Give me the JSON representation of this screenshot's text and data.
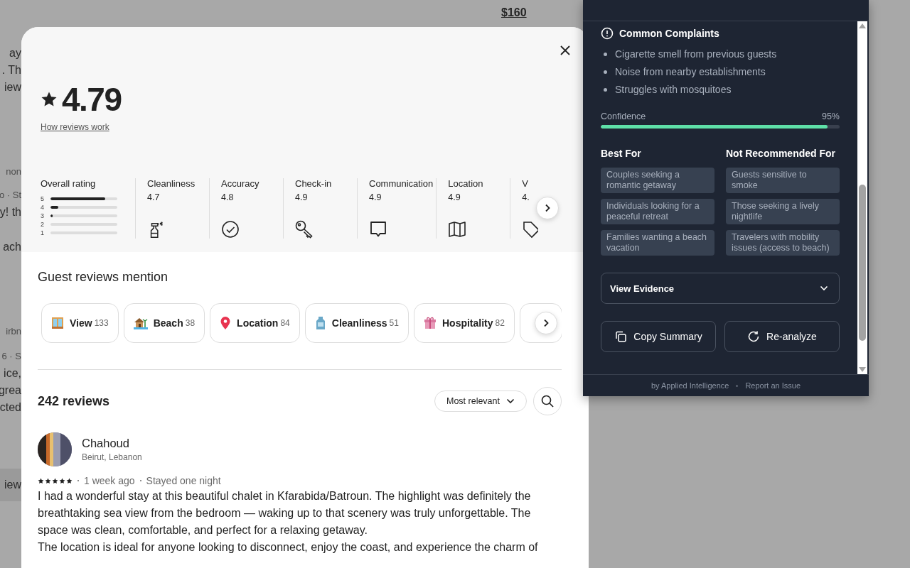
{
  "background_page": {
    "price": "$160",
    "fragments": [
      [
        {
          "text": "ay",
          "muted": false
        },
        {
          "text": ". Th",
          "muted": false
        },
        {
          "text": "iew",
          "muted": false
        }
      ],
      [
        {
          "text": "non",
          "muted": true
        }
      ],
      [
        {
          "text": "o · St",
          "muted": true
        },
        {
          "text": "y! th",
          "muted": false
        }
      ],
      [
        {
          "text": "ach",
          "muted": false
        }
      ],
      [
        {
          "text": "irbn",
          "muted": true
        }
      ],
      [
        {
          "text": "6 · S",
          "muted": true
        },
        {
          "text": "ice,",
          "muted": false
        },
        {
          "text": "grea",
          "muted": false
        },
        {
          "text": "cted",
          "muted": false
        }
      ],
      [
        {
          "text": "iew",
          "muted": false
        }
      ]
    ]
  },
  "reviews_modal": {
    "rating": "4.79",
    "how_link": "How reviews work",
    "overall": {
      "label": "Overall rating",
      "bars": [
        {
          "star": "5",
          "level": 0.82
        },
        {
          "star": "4",
          "level": 0.12
        },
        {
          "star": "3",
          "level": 0.03
        },
        {
          "star": "2",
          "level": 0
        },
        {
          "star": "1",
          "level": 0
        }
      ]
    },
    "categories": [
      {
        "kind": "spray",
        "name": "Cleanliness",
        "score": "4.7"
      },
      {
        "kind": "check",
        "name": "Accuracy",
        "score": "4.8"
      },
      {
        "kind": "key",
        "name": "Check-in",
        "score": "4.9"
      },
      {
        "kind": "message",
        "name": "Communication",
        "score": "4.9"
      },
      {
        "kind": "map",
        "name": "Location",
        "score": "4.9"
      },
      {
        "kind": "tag",
        "name": "V",
        "score": "4."
      }
    ],
    "mentions": {
      "title": "Guest reviews mention",
      "chips": [
        {
          "kind": "window",
          "label": "View",
          "count": "133"
        },
        {
          "kind": "hut",
          "label": "Beach",
          "count": "38"
        },
        {
          "kind": "pin",
          "label": "Location",
          "count": "84"
        },
        {
          "kind": "bottle",
          "label": "Cleanliness",
          "count": "51"
        },
        {
          "kind": "gift",
          "label": "Hospitality",
          "count": "82"
        }
      ]
    },
    "reviews": {
      "count": "242 reviews",
      "sort": "Most relevant",
      "items": [
        {
          "name": "Chahoud",
          "location": "Beirut, Lebanon",
          "stars": 5,
          "date": "1 week ago",
          "stay": "Stayed one night",
          "paragraphs": [
            "I had a wonderful stay at this beautiful chalet in Kfarabida/Batroun. The highlight was definitely the breathtaking sea view from the bedroom — waking up to that scenery was truly unforgettable. The space was clean, comfortable, and perfect for a relaxing getaway.",
            "The location is ideal for anyone looking to disconnect, enjoy the coast, and experience the charm of"
          ]
        }
      ]
    }
  },
  "analysis_panel": {
    "complaints": {
      "title": "Common Complaints",
      "items": [
        "Cigarette smell from previous guests",
        "Noise from nearby establishments",
        "Struggles with mosquitoes"
      ]
    },
    "confidence": {
      "label": "Confidence",
      "reading": "95%",
      "level": 0.95
    },
    "best_for": {
      "title": "Best For",
      "items": [
        "Couples seeking a romantic getaway",
        "Individuals looking for a peaceful retreat",
        "Families wanting a beach vacation"
      ]
    },
    "not_recommended": {
      "title": "Not Recommended For",
      "items": [
        "Guests sensitive to smoke",
        "Those seeking a lively nightlife",
        "Travelers with mobility issues (access to beach)"
      ]
    },
    "evidence": {
      "label": "View Evidence",
      "expanded": false
    },
    "buttons": [
      {
        "kind": "copy",
        "label": "Copy Summary"
      },
      {
        "kind": "refresh",
        "label": "Re-analyze"
      }
    ],
    "footer": {
      "credit": "by Applied Intelligence",
      "link": "Report an Issue"
    }
  }
}
